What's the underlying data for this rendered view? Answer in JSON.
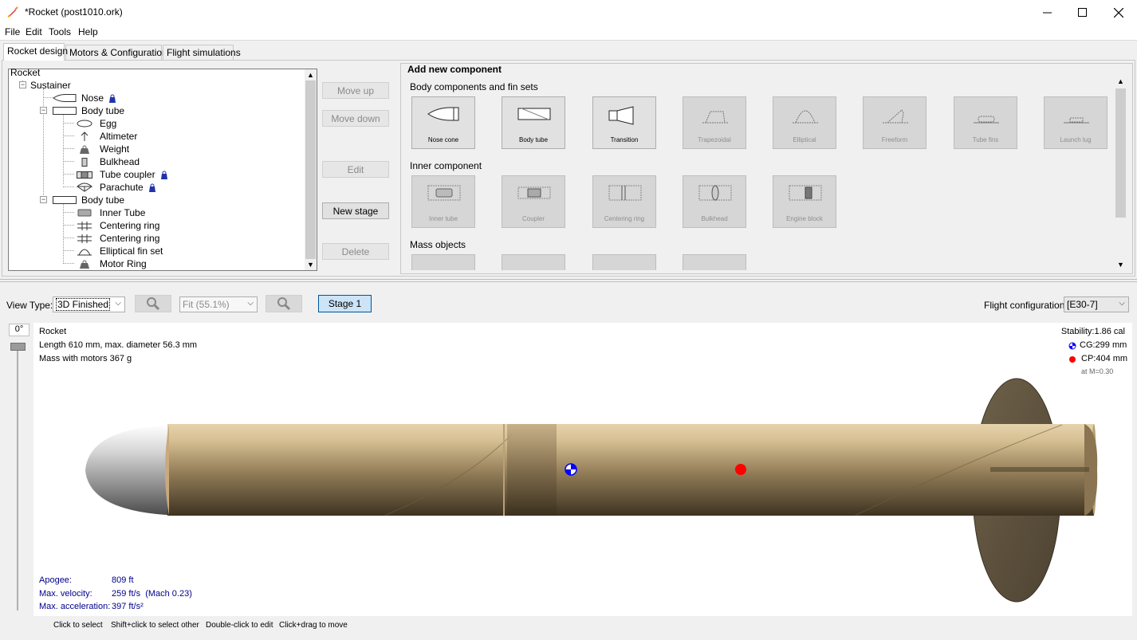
{
  "window": {
    "title": "*Rocket (post1010.ork)",
    "app_icon": "rocket-icon",
    "controls": [
      "minimize-icon",
      "maximize-icon",
      "close-icon"
    ]
  },
  "menu": [
    "File",
    "Edit",
    "Tools",
    "Help"
  ],
  "tabs": [
    {
      "label": "Rocket design",
      "active": true
    },
    {
      "label": "Motors & Configuration",
      "active": false
    },
    {
      "label": "Flight simulations",
      "active": false
    }
  ],
  "tree": {
    "items": [
      {
        "label": "Rocket"
      },
      {
        "label": "Sustainer"
      },
      {
        "label": "Nose"
      },
      {
        "label": "Body tube"
      },
      {
        "label": "Egg"
      },
      {
        "label": "Altimeter"
      },
      {
        "label": "Weight"
      },
      {
        "label": "Bulkhead"
      },
      {
        "label": "Tube coupler"
      },
      {
        "label": "Parachute"
      },
      {
        "label": "Body tube"
      },
      {
        "label": "Inner Tube"
      },
      {
        "label": "Centering ring"
      },
      {
        "label": "Centering ring"
      },
      {
        "label": "Elliptical fin set"
      },
      {
        "label": "Motor Ring"
      }
    ]
  },
  "side_buttons": {
    "move_up": "Move up",
    "move_down": "Move down",
    "edit": "Edit",
    "new_stage": "New stage",
    "delete": "Delete"
  },
  "add_component": {
    "title": "Add new component",
    "body_section": "Body components and fin sets",
    "body_components": [
      "Nose cone",
      "Body tube",
      "Transition",
      "Trapezoidal",
      "Elliptical",
      "Freeform",
      "Tube fins",
      "Launch lug"
    ],
    "inner_section": "Inner component",
    "inner_components": [
      "Inner tube",
      "Coupler",
      "Centering ring",
      "Bulkhead",
      "Engine block"
    ],
    "mass_section": "Mass objects"
  },
  "view_toolbar": {
    "view_type_label": "View Type:",
    "view_type_value": "3D Finished",
    "zoom_value": "Fit (55.1%)",
    "stage_button": "Stage 1",
    "flight_config_label": "Flight configuration:",
    "flight_config_value": "[E30-7]"
  },
  "rotation": {
    "label": "0°"
  },
  "rocket_info": {
    "name": "Rocket",
    "length": "Length 610 mm, max. diameter 56.3 mm",
    "mass": "Mass with motors 367 g"
  },
  "stability": {
    "stability": "Stability:1.86 cal",
    "cg": "CG:299 mm",
    "cp": "CP:404 mm",
    "mach": "at M=0.30",
    "colors": {
      "cg": "#0000ff",
      "cp": "#ff0000"
    }
  },
  "flight_data": [
    {
      "label": "Apogee:",
      "value": "809 ft"
    },
    {
      "label": "Max. velocity:",
      "value": "259 ft/s  (Mach 0.23)"
    },
    {
      "label": "Max. acceleration:",
      "value": "397 ft/s²"
    }
  ],
  "hints": [
    "Click to select",
    "Shift+click to select other",
    "Double-click to edit",
    "Click+drag to move"
  ]
}
